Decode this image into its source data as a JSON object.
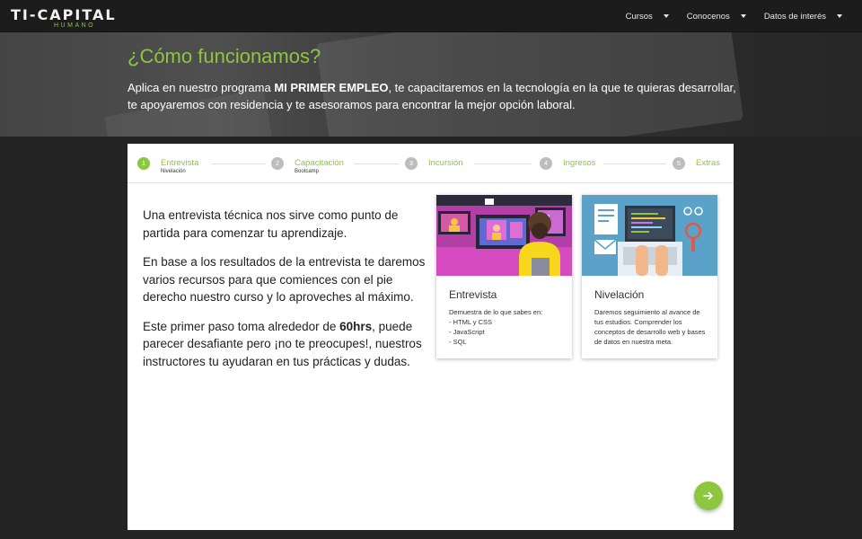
{
  "brand": {
    "logo_main": "TI-CAPITAL",
    "logo_sub": "HUMANO",
    "accent": "#8dc63f"
  },
  "nav": [
    {
      "label": "Cursos"
    },
    {
      "label": "Conocenos"
    },
    {
      "label": "Datos de interés"
    }
  ],
  "hero": {
    "title": "¿Cómo funcionamos?",
    "desc_pre": "Aplica en nuestro programa ",
    "desc_bold": "MI PRIMER EMPLEO",
    "desc_post": ", te capacitaremos en la tecnología en la que te quieras desarrollar, te apoyaremos con residencia y te asesoramos para encontrar la mejor opción laboral."
  },
  "steps": [
    {
      "num": "1",
      "label": "Entrevista",
      "sub": "Nivelación"
    },
    {
      "num": "2",
      "label": "Capacitación",
      "sub": "Bootcamp"
    },
    {
      "num": "3",
      "label": "Incursión",
      "sub": ""
    },
    {
      "num": "4",
      "label": "Ingresos",
      "sub": ""
    },
    {
      "num": "5",
      "label": "Extras",
      "sub": ""
    }
  ],
  "content": {
    "p1": "Una entrevista técnica nos sirve como punto de partida para comenzar tu aprendizaje.",
    "p2": "En base a los resultados de la entrevista te daremos varios recursos para que comiences con el pie derecho nuestro curso y lo aproveches al máximo.",
    "p3_pre": "Este primer paso toma alrededor de ",
    "p3_bold": "60hrs",
    "p3_post": ", puede parecer desafiante pero ¡no te preocupes!, nuestros instructores tu ayudaran en tus prácticas y dudas."
  },
  "cards": [
    {
      "title": "Entrevista",
      "intro": "Demuestra de lo que sabes en:",
      "items": [
        "- HTML y CSS",
        "- JavaScript",
        "- SQL"
      ]
    },
    {
      "title": "Nivelación",
      "body": "Daremos seguimiento al avance de tus estudios. Comprender los conceptos de desarrollo web y bases de datos en nuestra meta."
    }
  ],
  "next_icon": "arrow-right-icon"
}
